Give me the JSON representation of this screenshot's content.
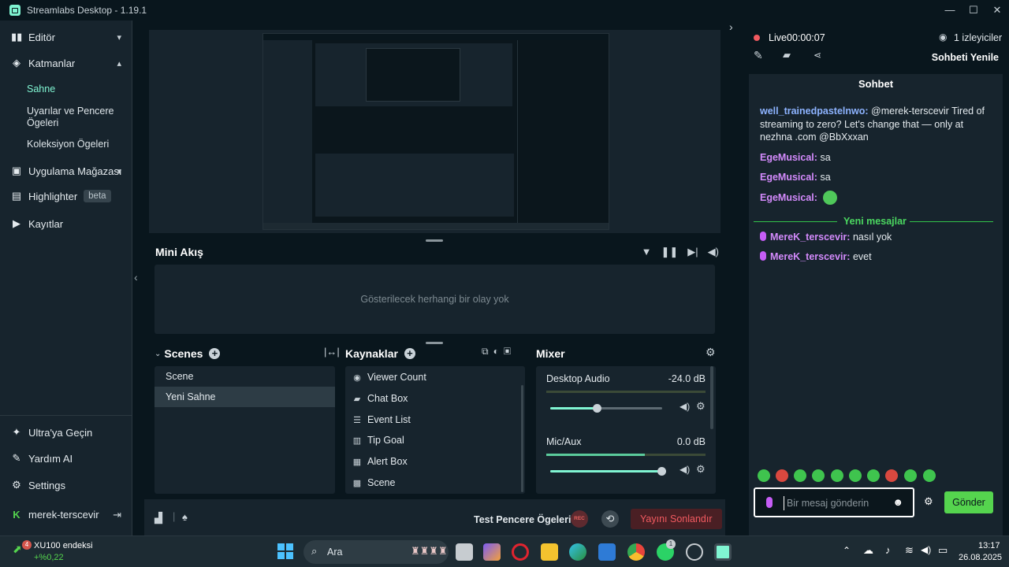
{
  "window": {
    "title": "Streamlabs Desktop - 1.19.1",
    "minimize": "—",
    "maximize": "☐",
    "close": "✕"
  },
  "sidebar": {
    "editor": "Editör",
    "layers": "Katmanlar",
    "layers_sub": [
      "Sahne",
      "Uyarılar ve Pencere Ögeleri",
      "Koleksiyon Ögeleri"
    ],
    "app_store": "Uygulama Mağazası",
    "highlighter": "Highlighter",
    "beta": "beta",
    "recordings": "Kayıtlar",
    "ultra": "Ultra'ya Geçin",
    "help": "Yardım AI",
    "settings": "Settings",
    "user": "merek-terscevir"
  },
  "mini_feed": {
    "title": "Mini Akış",
    "empty": "Gösterilecek herhangi bir olay yok"
  },
  "scenes": {
    "title": "Scenes",
    "items": [
      "Scene",
      "Yeni Sahne"
    ],
    "selected": "Yeni Sahne"
  },
  "sources": {
    "title": "Kaynaklar",
    "items": [
      {
        "label": "Viewer Count",
        "icon": "eye-icon"
      },
      {
        "label": "Chat Box",
        "icon": "chat-icon"
      },
      {
        "label": "Event List",
        "icon": "list-icon"
      },
      {
        "label": "Tip Goal",
        "icon": "goal-icon"
      },
      {
        "label": "Alert Box",
        "icon": "alert-icon"
      },
      {
        "label": "Scene",
        "icon": "scene-icon"
      }
    ]
  },
  "mixer": {
    "title": "Mixer",
    "channels": [
      {
        "name": "Desktop Audio",
        "db": "-24.0 dB",
        "volume": 0.42,
        "meter": 0
      },
      {
        "name": "Mic/Aux",
        "db": "0.0 dB",
        "volume": 1.0,
        "meter": 0.62
      }
    ]
  },
  "footer": {
    "test_widgets": "Test Pencere Ögeleri",
    "rec": "REC",
    "end_stream": "Yayını Sonlandır"
  },
  "stream": {
    "live": "Live",
    "time": "00:00:07",
    "viewers": "1 izleyiciler",
    "refresh_chat": "Sohbeti Yenile"
  },
  "chat": {
    "title": "Sohbet",
    "messages": [
      {
        "user": "well_trainedpastelnwo",
        "text": "@merek-terscevir Tired of streaming to zero? Let's change that — only at nezhna .com @BbXxxan"
      },
      {
        "user": "EgeMusical",
        "text": "sa"
      },
      {
        "user": "EgeMusical",
        "text": "sa"
      },
      {
        "user": "EgeMusical",
        "text": ""
      }
    ],
    "new_messages": "Yeni mesajlar",
    "new": [
      {
        "user": "MereK_terscevir",
        "text": "nasıl yok"
      },
      {
        "user": "MereK_terscevir",
        "text": "evet"
      }
    ],
    "placeholder": "Bir mesaj gönderin",
    "send": "Gönder"
  },
  "taskbar": {
    "widget_name": "XU100 endeksi",
    "widget_value": "+%0,22",
    "widget_badge": "4",
    "search": "Ara",
    "whatsapp_badge": "1",
    "time": "13:17",
    "date": "26.08.2025"
  },
  "colors": {
    "accent": "#80f5d2",
    "live": "#f15a60",
    "send": "#55d44e",
    "bg": "#09161d",
    "panel": "#17242d"
  }
}
